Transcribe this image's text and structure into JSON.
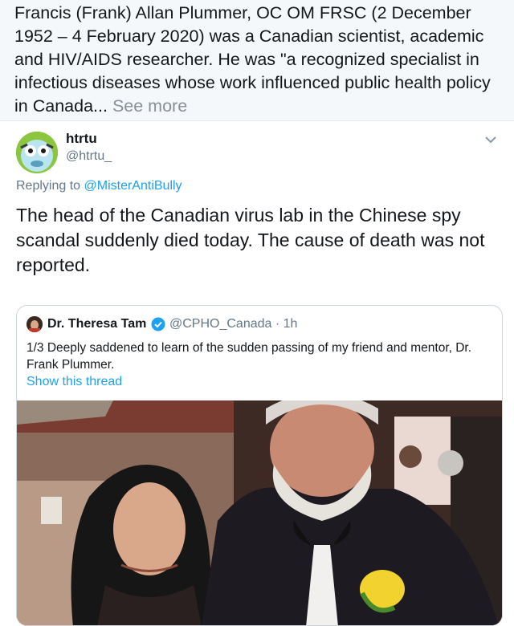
{
  "wiki_snippet": {
    "text": "Francis (Frank) Allan Plummer, OC OM FRSC (2 December 1952 – 4 February 2020) was a Canadian scientist, academic and HIV/AIDS researcher. He was \"a recognized specialist in infectious diseases whose work influenced public health policy in Canada...",
    "see_more": "See more"
  },
  "tweet": {
    "display_name": "htrtu",
    "handle": "@htrtu_",
    "replying_prefix": "Replying to",
    "replying_to": "@MisterAntiBully",
    "text": "The head of the Canadian virus lab in the Chinese spy scandal suddenly died today. The cause of death was not reported.",
    "avatar_icon": "cartoon-avatar-icon",
    "menu_icon": "chevron-down-icon"
  },
  "quoted_tweet": {
    "display_name": "Dr. Theresa Tam",
    "verified_icon": "verified-badge-icon",
    "handle_time": "@CPHO_Canada · 1h",
    "text": "1/3 Deeply saddened to learn of the sudden passing of my friend and mentor, Dr. Frank Plummer.",
    "show_thread": "Show this thread"
  },
  "colors": {
    "link": "#1da1f2",
    "secondary_text": "#657786",
    "snippet_bg": "#f5f8fa"
  }
}
